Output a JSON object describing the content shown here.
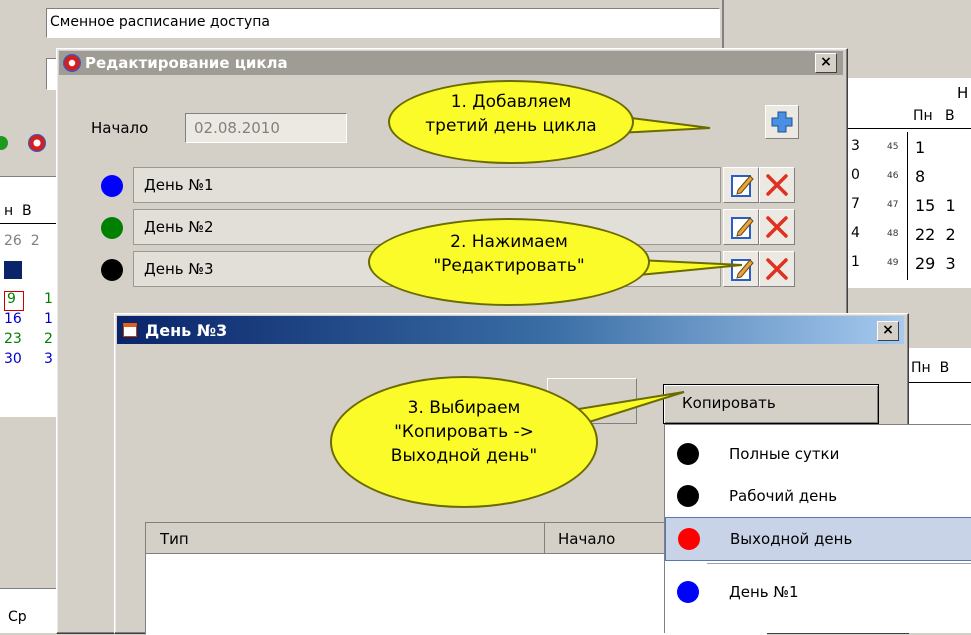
{
  "background": {
    "top_field": "Сменное расписание доступа",
    "left_calendar": {
      "header": "н  В",
      "row1": "26  2",
      "row3": [
        "9",
        "1"
      ],
      "row4": [
        "16",
        "1"
      ],
      "row5": [
        "23",
        "2"
      ],
      "row6": [
        "30",
        "3"
      ]
    },
    "right_calendar": {
      "month_fragment": "Н",
      "headers": [
        "Пн",
        "В"
      ],
      "rows": [
        {
          "left": "3",
          "week": "45",
          "days": "1"
        },
        {
          "left": "0",
          "week": "46",
          "days": "8"
        },
        {
          "left": "7",
          "week": "47",
          "days": "15  1"
        },
        {
          "left": "4",
          "week": "48",
          "days": "22  2"
        },
        {
          "left": "1",
          "week": "49",
          "days": "29  3"
        }
      ]
    },
    "right_calendar2_header": "Пн  В",
    "bottom_left": [
      "Ср"
    ]
  },
  "cycle_dialog": {
    "title": "Редактирование цикла",
    "start_label": "Начало",
    "start_value": "02.08.2010",
    "days": [
      {
        "label": "День №1",
        "color": "#0000ff"
      },
      {
        "label": "День №2",
        "color": "#008000"
      },
      {
        "label": "День №3",
        "color": "#000000"
      }
    ]
  },
  "day_dialog": {
    "title": "День №3",
    "copy_button": "Копировать",
    "table_headers": [
      "Тип",
      "Начало"
    ]
  },
  "copy_menu": [
    {
      "label": "Полные сутки",
      "color": "#000000",
      "selected": false
    },
    {
      "label": "Рабочий день",
      "color": "#000000",
      "selected": false
    },
    {
      "label": "Выходной день",
      "color": "#ff0000",
      "selected": true
    },
    {
      "label": "День №1",
      "color": "#0000ff",
      "selected": false
    }
  ],
  "callouts": {
    "c1": [
      "1. Добавляем",
      "третий день цикла"
    ],
    "c2": [
      "2. Нажимаем",
      "\"Редактировать\""
    ],
    "c3": [
      "3. Выбираем",
      "\"Копировать ->",
      "Выходной день\""
    ]
  }
}
